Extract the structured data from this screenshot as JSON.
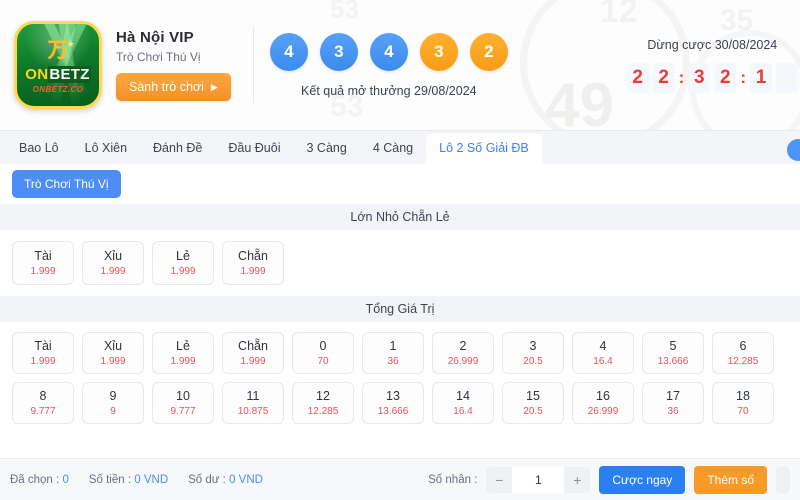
{
  "header": {
    "logo": {
      "mark": "万",
      "star": "★",
      "word_on": "ON",
      "word_betz": "BETZ",
      "sub": "ONBETZ.CO"
    },
    "brand_title": "Hà Nội VIP",
    "brand_sub": "Trò Chơi Thú Vị",
    "lobby_button": "Sành trò chơi",
    "lobby_arrow": "▶"
  },
  "results": {
    "caption": "Kết quả mở thưởng 29/08/2024",
    "balls": [
      {
        "value": "4",
        "color": "blue"
      },
      {
        "value": "3",
        "color": "blue"
      },
      {
        "value": "4",
        "color": "blue"
      },
      {
        "value": "3",
        "color": "orange"
      },
      {
        "value": "2",
        "color": "orange"
      }
    ]
  },
  "countdown": {
    "label": "Dừng cược 30/08/2024",
    "digits": [
      "2",
      "2",
      ":",
      "3",
      "2",
      ":",
      "1",
      ""
    ]
  },
  "tabs": [
    {
      "label": "Bao Lô",
      "active": false
    },
    {
      "label": "Lô Xiên",
      "active": false
    },
    {
      "label": "Đánh Đề",
      "active": false
    },
    {
      "label": "Đầu Đuôi",
      "active": false
    },
    {
      "label": "3 Càng",
      "active": false
    },
    {
      "label": "4 Càng",
      "active": false
    },
    {
      "label": "Lô 2 Số Giải ĐB",
      "active": true
    }
  ],
  "subtab": {
    "label": "Trò Chơi Thú Vị"
  },
  "section1": {
    "title": "Lớn Nhỏ Chẵn Lẻ",
    "cards": [
      {
        "label": "Tài",
        "odds": "1.999"
      },
      {
        "label": "Xỉu",
        "odds": "1.999"
      },
      {
        "label": "Lẻ",
        "odds": "1.999"
      },
      {
        "label": "Chẵn",
        "odds": "1.999"
      }
    ]
  },
  "section2": {
    "title": "Tổng Giá Trị",
    "cards": [
      {
        "label": "Tài",
        "odds": "1.999"
      },
      {
        "label": "Xỉu",
        "odds": "1.999"
      },
      {
        "label": "Lẻ",
        "odds": "1.999"
      },
      {
        "label": "Chẵn",
        "odds": "1.999"
      },
      {
        "label": "0",
        "odds": "70"
      },
      {
        "label": "1",
        "odds": "36"
      },
      {
        "label": "2",
        "odds": "26.999"
      },
      {
        "label": "3",
        "odds": "20.5"
      },
      {
        "label": "4",
        "odds": "16.4"
      },
      {
        "label": "5",
        "odds": "13.666"
      },
      {
        "label": "6",
        "odds": "12.285"
      },
      {
        "label": "8",
        "odds": "9.777"
      },
      {
        "label": "9",
        "odds": "9"
      },
      {
        "label": "10",
        "odds": "9.777"
      },
      {
        "label": "11",
        "odds": "10.875"
      },
      {
        "label": "12",
        "odds": "12.285"
      },
      {
        "label": "13",
        "odds": "13.666"
      },
      {
        "label": "14",
        "odds": "16.4"
      },
      {
        "label": "15",
        "odds": "20.5"
      },
      {
        "label": "16",
        "odds": "26.999"
      },
      {
        "label": "17",
        "odds": "36"
      },
      {
        "label": "18",
        "odds": "70"
      }
    ]
  },
  "bottombar": {
    "selected_label": "Đã chọn :",
    "selected_value": "0",
    "amount_label": "Số tiền :",
    "amount_value": "0 VND",
    "balance_label": "Số dư :",
    "balance_value": "0 VND",
    "multiplier_label": "Số nhân :",
    "multiplier_value": "1",
    "minus": "−",
    "plus": "+",
    "bet_button": "Cược ngay",
    "add_button": "Thêm số"
  },
  "watermark": {
    "n49": "49",
    "n12": "12",
    "n53a": "53",
    "n53b": "53",
    "n35": "35"
  },
  "colors": {
    "accent_blue": "#3b82f6",
    "accent_orange": "#f79a28",
    "odds_red": "#e8535a",
    "timer_red": "#ec3b3b"
  }
}
